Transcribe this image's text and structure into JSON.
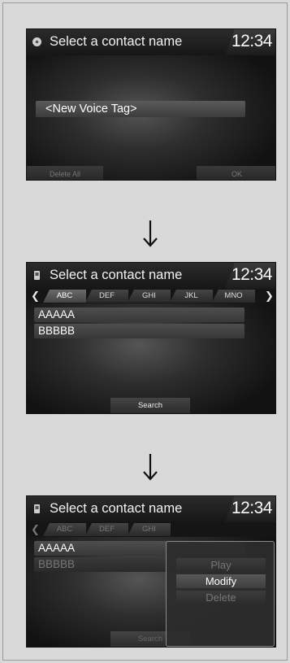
{
  "screens": [
    {
      "title": "Select a contact name",
      "clock": "12:34",
      "new_voice_tag": "<New Voice Tag>",
      "delete_all": "Delete All",
      "ok": "OK"
    },
    {
      "title": "Select a contact name",
      "clock": "12:34",
      "tabs": [
        "ABC",
        "DEF",
        "GHI",
        "JKL",
        "MNO"
      ],
      "contacts": [
        "AAAAA",
        "BBBBB"
      ],
      "search": "Search"
    },
    {
      "title": "Select a contact name",
      "clock": "12:34",
      "tabs": [
        "ABC",
        "DEF",
        "GHI"
      ],
      "contacts": [
        "AAAAA",
        "BBBBB"
      ],
      "search": "Search",
      "menu": [
        "Play",
        "Modify",
        "Delete"
      ],
      "menu_selected": "Modify"
    }
  ],
  "icons": {
    "screen1_header": "disc-icon",
    "screen2_header": "phone-icon",
    "screen3_header": "phone-icon",
    "flow_arrow": "down-arrow-icon"
  }
}
